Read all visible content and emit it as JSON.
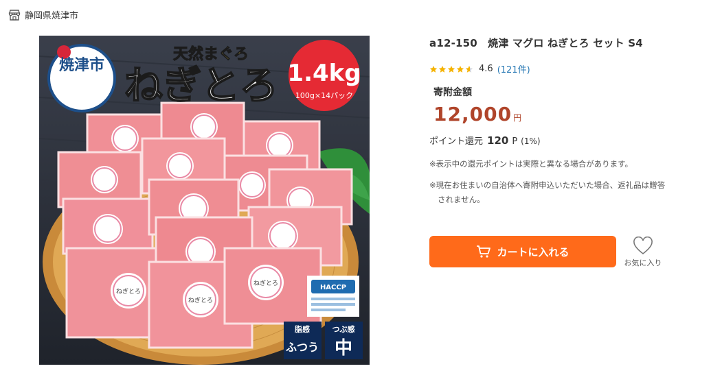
{
  "municipality": {
    "name": "静岡県焼津市",
    "icon": "store-icon"
  },
  "product": {
    "image_alt": "天然まぐろ ねぎとろ 1.4kg",
    "image_texts": {
      "label_top": "天然まぐろ",
      "label_main": "ねぎとろ",
      "weight": "1.4kg",
      "pack": "100g×14パック",
      "emblem": "焼津市",
      "pack_label": "ねぎとろ",
      "badge_fat": "脂感",
      "badge_fat_value": "ふつう",
      "badge_grain": "つぶ感",
      "badge_grain_value": "中",
      "haccp": "HACCP"
    },
    "title": "a12-150　焼津 マグロ ねぎとろ セット S4",
    "rating": {
      "value": "4.6",
      "count": "(121件)",
      "stars": 4.6
    },
    "donation_label": "寄附金額",
    "price": "12,000",
    "currency": "円",
    "points": {
      "label": "ポイント還元",
      "value": "120",
      "unit": "P",
      "rate": "(1%)"
    },
    "notes": [
      "※表示中の還元ポイントは実際と異なる場合があります。",
      "※現在お住まいの自治体へ寄附申込いただいた場合、返礼品は贈答されません。"
    ]
  },
  "actions": {
    "cart_label": "カートに入れる",
    "favorite_label": "お気に入り"
  },
  "colors": {
    "accent": "#ff6a1a",
    "price": "#b0452b",
    "star": "#f5b301",
    "link": "#2a7ab5"
  }
}
